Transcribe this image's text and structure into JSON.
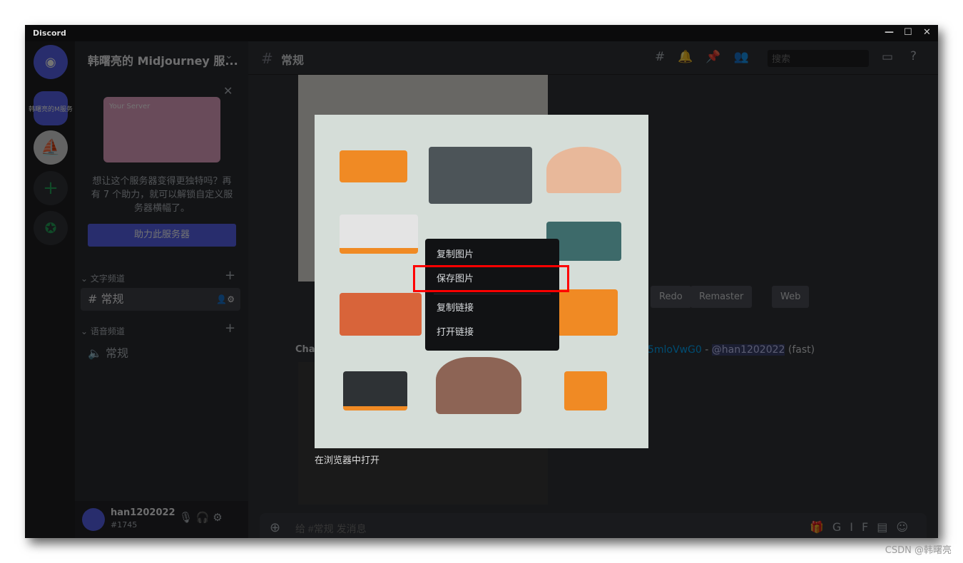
{
  "app": {
    "title": "Discord"
  },
  "server": {
    "name": "韩曙亮的 Midjourney 服...",
    "icon_label": "韩曙亮的M服务"
  },
  "boost": {
    "text": "想让这个服务器变得更独特吗？再有 7 个助力，就可以解锁自定义服务器横幅了。",
    "button": "助力此服务器",
    "card_label": "Your Server"
  },
  "categories": [
    {
      "label": "文字频道",
      "channel": "常规"
    },
    {
      "label": "语音频道",
      "channel": "常规"
    }
  ],
  "user": {
    "name": "han1202022",
    "tag": "#1745"
  },
  "header": {
    "channel": "常规",
    "search_placeholder": "搜索"
  },
  "message": {
    "buttons": [
      "Redo",
      "Remaster",
      "Web"
    ],
    "author_fragment": "Cha",
    "link_fragment": "5mloVwG0",
    "mention": "@han1202022",
    "suffix": "(fast)"
  },
  "composer": {
    "placeholder": "给 #常规 发消息"
  },
  "context_menu": {
    "items": [
      "复制图片",
      "保存图片",
      "复制链接",
      "打开链接"
    ],
    "highlighted": "保存图片"
  },
  "viewer": {
    "open_in_browser": "在浏览器中打开"
  },
  "watermark": "CSDN @韩曙亮",
  "colors": {
    "highlight_box": "#ff0000",
    "image_bg": "#d5ddd8",
    "accent": "#5865f2"
  }
}
